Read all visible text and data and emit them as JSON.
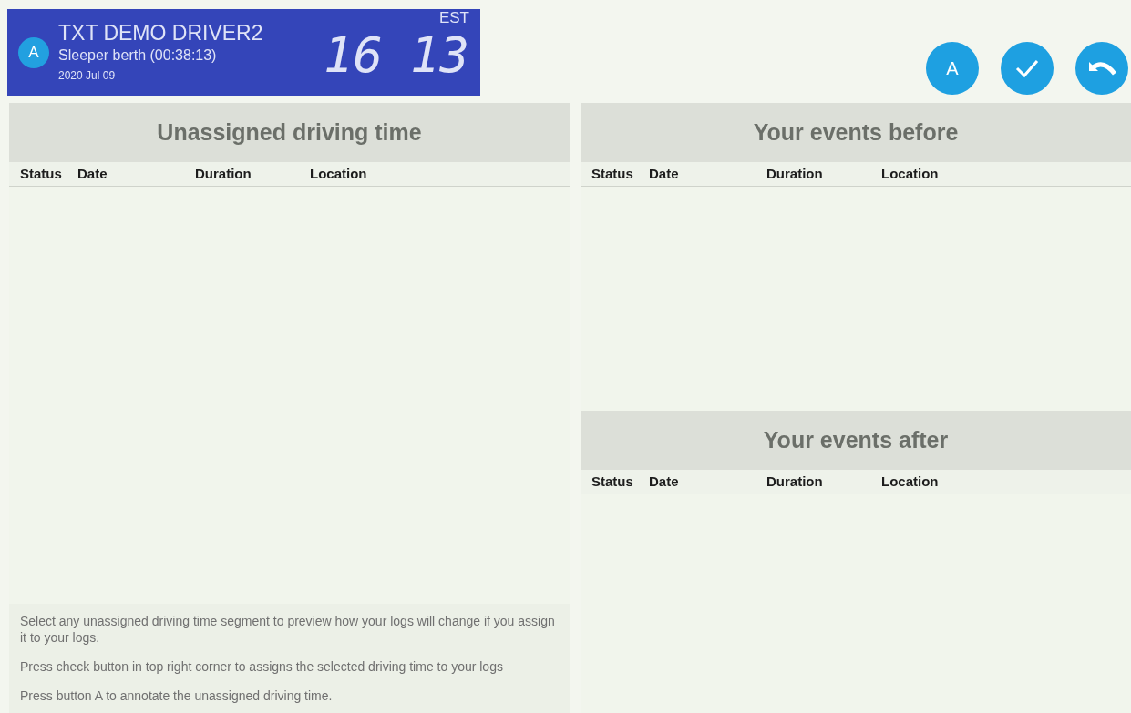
{
  "driver": {
    "avatar": "A",
    "name": "TXT DEMO DRIVER2",
    "status": "Sleeper berth (00:38:13)",
    "date": "2020 Jul 09",
    "timezone": "EST",
    "clock": [
      "16",
      "13"
    ]
  },
  "actions": [
    {
      "kind": "letter",
      "label": "A"
    },
    {
      "kind": "check"
    },
    {
      "kind": "undo"
    }
  ],
  "panels": [
    {
      "title": "Unassigned driving time",
      "columns": [
        "Status",
        "Date",
        "Duration",
        "Location"
      ],
      "notes": [
        "Select any unassigned driving time segment to preview how your logs will change if you assign it to your logs.",
        "Press check button in top right corner to assigns the selected driving time to your logs",
        "Press button A to annotate the unassigned driving time."
      ]
    },
    {
      "title": "Your events before",
      "columns": [
        "Status",
        "Date",
        "Duration",
        "Location"
      ]
    },
    {
      "title": "Your events after",
      "columns": [
        "Status",
        "Date",
        "Duration",
        "Location"
      ]
    }
  ]
}
